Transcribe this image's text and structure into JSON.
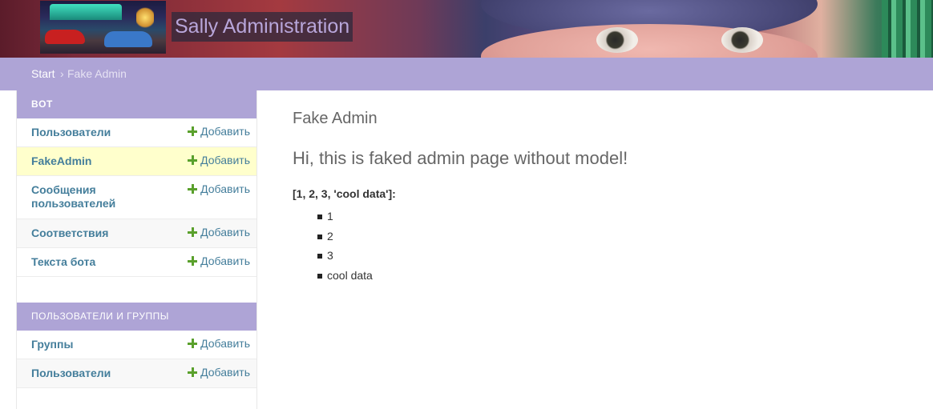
{
  "header": {
    "site_title": "Sally Administration"
  },
  "breadcrumbs": {
    "home": "Start",
    "separator": "›",
    "current": "Fake Admin"
  },
  "sidebar": {
    "add_label": "Добавить",
    "modules": [
      {
        "caption": "BOT",
        "models": [
          {
            "name": "Пользователи"
          },
          {
            "name": "FakeAdmin"
          },
          {
            "name": "Сообщения пользователей"
          },
          {
            "name": "Соответствия"
          },
          {
            "name": "Текста бота"
          }
        ]
      },
      {
        "caption": "ПОЛЬЗОВАТЕЛИ И ГРУППЫ",
        "models": [
          {
            "name": "Группы"
          },
          {
            "name": "Пользователи"
          }
        ]
      }
    ]
  },
  "content": {
    "title": "Fake Admin",
    "subtitle": "Hi, this is faked admin page without model!",
    "list_heading": "[1, 2, 3, 'cool data']:",
    "items": [
      "1",
      "2",
      "3",
      "cool data"
    ]
  },
  "colors": {
    "accent": "#aea4d6",
    "link": "#447e9b",
    "add_icon": "#5aa02c",
    "selected_row": "#ffffcc"
  }
}
